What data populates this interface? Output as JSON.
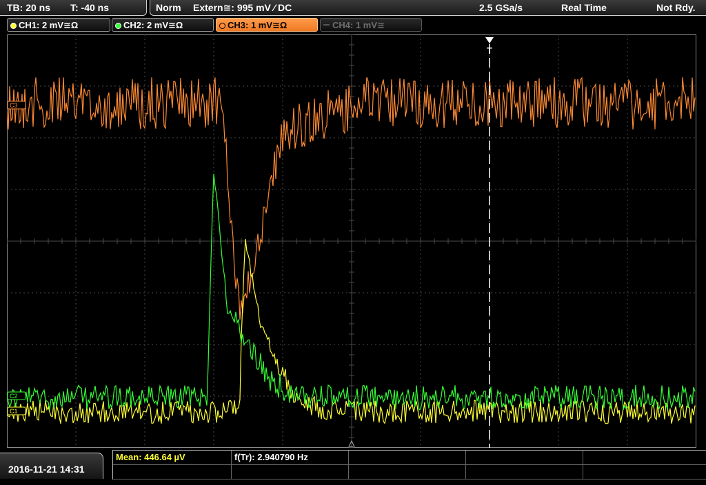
{
  "header": {
    "timebase": "TB: 20 ns",
    "trigger_time": "T: -40 ns",
    "mode": "Norm",
    "trigger_source": "Extern≅: 995 mV ⁄ DC",
    "sample_rate": "2.5 GSa/s",
    "acq_mode": "Real Time",
    "status": "Not Rdy."
  },
  "channels": [
    {
      "label": "CH1: 2 mV≅Ω",
      "color": "#ffff33",
      "active": true
    },
    {
      "label": "CH2: 2 mV≅Ω",
      "color": "#33ff33",
      "active": true
    },
    {
      "label": "CH3: 1 mV≅Ω",
      "color": "#ff8a33",
      "active": true,
      "selected": true
    },
    {
      "label": "CH4: 1 mV≅",
      "color": "#555555",
      "active": false
    }
  ],
  "markers": {
    "ch3": "C3",
    "ch2": "C2",
    "ch1": "C1",
    "trigger": "T"
  },
  "footer": {
    "datetime": "2016-11-21 14:31",
    "mean_label": "Mean: 446.64 µV",
    "freq_label": "f(Tr): 2.940790 Hz"
  },
  "colors": {
    "ch1": "#ffff33",
    "ch2": "#33ff33",
    "ch3": "#ff8a33",
    "grid": "#4a4a4a",
    "background": "#000000"
  }
}
